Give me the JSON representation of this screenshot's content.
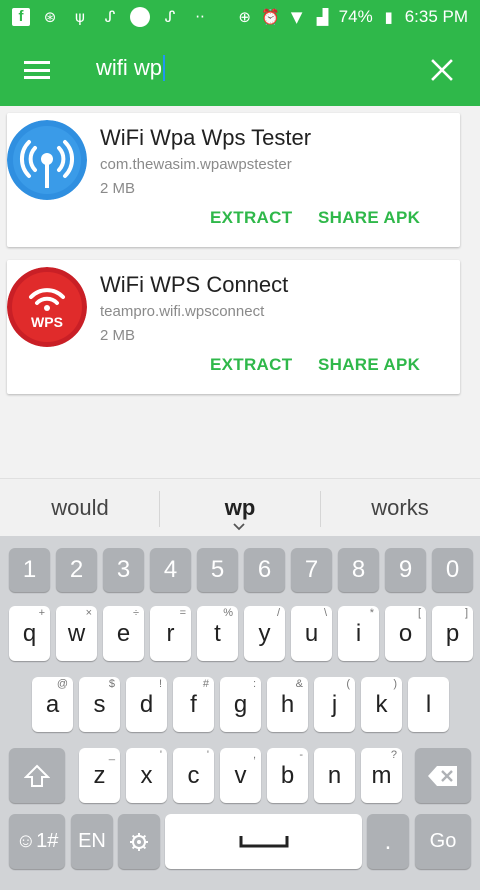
{
  "status_bar": {
    "battery": "74%",
    "time": "6:35 PM"
  },
  "app_bar": {
    "search_query": "wifi wp"
  },
  "apps": [
    {
      "name": "WiFi Wpa Wps Tester",
      "package": "com.thewasim.wpawpstester",
      "size": "2 MB",
      "extract_label": "EXTRACT",
      "share_label": "SHARE APK",
      "icon": "wifi-antenna-icon",
      "icon_color": "#2f8fe0"
    },
    {
      "name": "WiFi WPS Connect",
      "package": "teampro.wifi.wpsconnect",
      "size": "2 MB",
      "extract_label": "EXTRACT",
      "share_label": "SHARE APK",
      "icon": "wps-logo-icon",
      "icon_color": "#e02b2b",
      "icon_text": "WPS"
    }
  ],
  "suggestions": [
    "would",
    "wp",
    "works"
  ],
  "keyboard": {
    "numbers": [
      "1",
      "2",
      "3",
      "4",
      "5",
      "6",
      "7",
      "8",
      "9",
      "0"
    ],
    "row1": [
      "q",
      "w",
      "e",
      "r",
      "t",
      "y",
      "u",
      "i",
      "o",
      "p"
    ],
    "row1_hints": [
      "+",
      "×",
      "÷",
      "=",
      "%",
      "/",
      "\\",
      "*",
      "[",
      "]"
    ],
    "row2": [
      "a",
      "s",
      "d",
      "f",
      "g",
      "h",
      "j",
      "k",
      "l"
    ],
    "row2_hints": [
      "@",
      "$",
      "!",
      "#",
      ":",
      "&",
      "(",
      ")",
      ""
    ],
    "row3": [
      "z",
      "x",
      "c",
      "v",
      "b",
      "n",
      "m"
    ],
    "row3_hints": [
      "_",
      "'",
      "'",
      ",",
      "-",
      "",
      "?"
    ],
    "sym_label": "☺1#",
    "lang_label": "EN",
    "period_label": ".",
    "go_label": "Go"
  },
  "colors": {
    "accent": "#2fb84a",
    "blue_icon": "#2f8fe0",
    "red_icon": "#e02b2b"
  }
}
